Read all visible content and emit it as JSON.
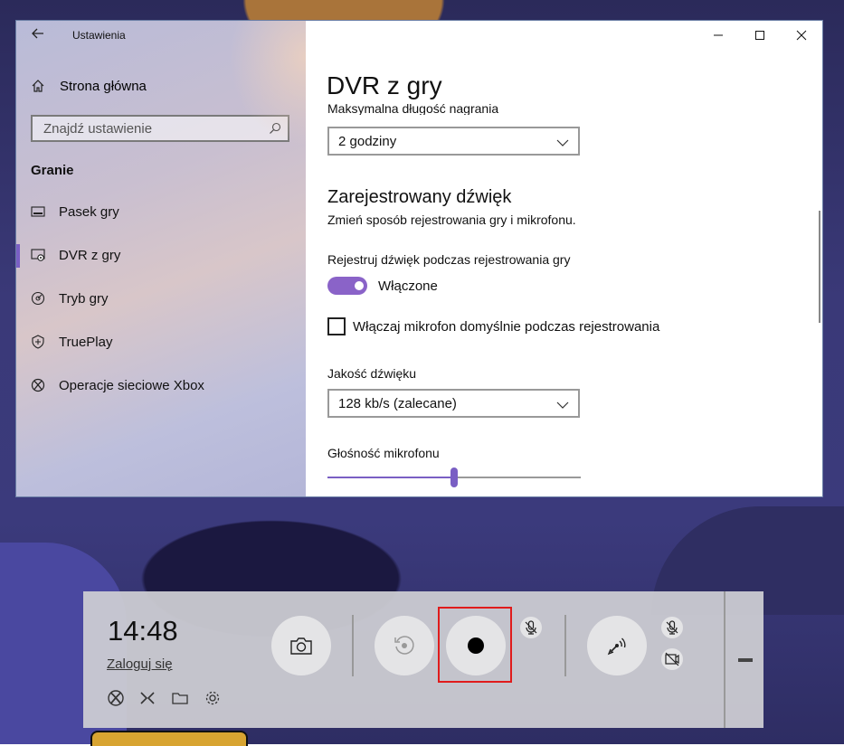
{
  "window": {
    "app_title": "Ustawienia",
    "controls": [
      "minimize",
      "maximize",
      "close"
    ]
  },
  "sidebar": {
    "home_label": "Strona główna",
    "search_placeholder": "Znajdź ustawienie",
    "section_title": "Granie",
    "items": [
      {
        "label": "Pasek gry",
        "icon": "game-bar-icon",
        "active": false
      },
      {
        "label": "DVR z gry",
        "icon": "game-dvr-icon",
        "active": true
      },
      {
        "label": "Tryb gry",
        "icon": "game-mode-icon",
        "active": false
      },
      {
        "label": "TruePlay",
        "icon": "trueplay-icon",
        "active": false
      },
      {
        "label": "Operacje sieciowe Xbox",
        "icon": "xbox-icon",
        "active": false
      }
    ]
  },
  "main": {
    "title": "DVR z gry",
    "max_length_label": "Maksymalna długość nagrania",
    "max_length_value": "2 godziny",
    "audio_heading": "Zarejestrowany dźwięk",
    "audio_desc": "Zmień sposób rejestrowania gry i mikrofonu.",
    "record_audio_label": "Rejestruj dźwięk podczas rejestrowania gry",
    "toggle_state_label": "Włączone",
    "toggle_on": true,
    "mic_checkbox_label": "Włączaj mikrofon domyślnie podczas rejestrowania",
    "mic_checkbox_checked": false,
    "quality_label": "Jakość dźwięku",
    "quality_value": "128 kb/s (zalecane)",
    "mic_volume_label": "Głośność mikrofonu",
    "mic_volume_level": 0.5
  },
  "gamebar": {
    "time": "14:48",
    "signin_label": "Zaloguj się",
    "accent_highlight": "#e01b1b"
  },
  "colors": {
    "accent": "#7a5fc4",
    "toggle": "#8a63c8"
  }
}
